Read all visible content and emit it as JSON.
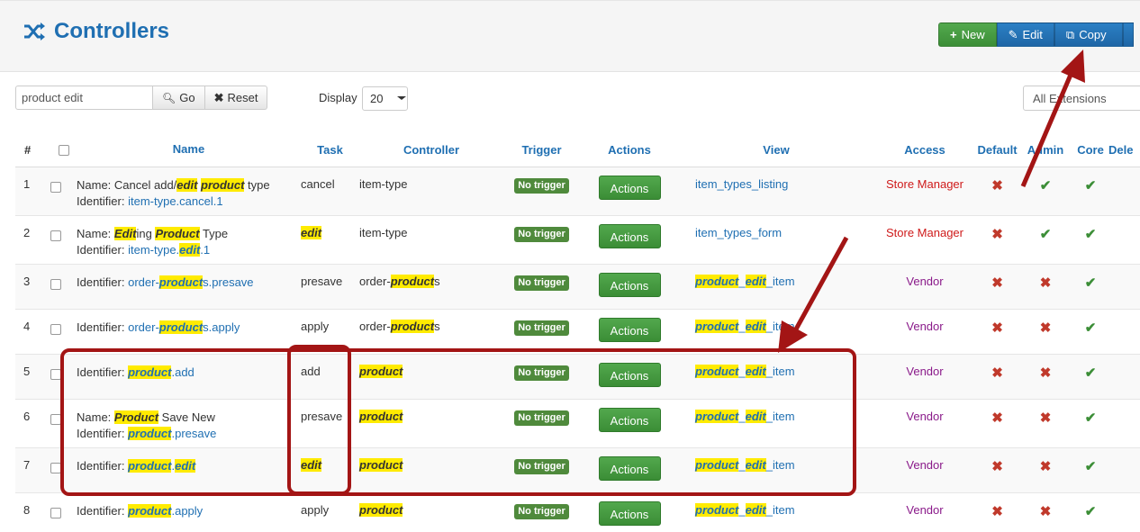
{
  "header": {
    "title": "Controllers",
    "title_icon": "shuffle-icon",
    "toolbar": {
      "new_label": "New",
      "edit_label": "Edit",
      "copy_label": "Copy"
    }
  },
  "filters": {
    "search_value": "product edit",
    "go_label": "Go",
    "reset_label": "Reset",
    "display_label": "Display",
    "display_value": "20",
    "extensions_value": "All Extensions"
  },
  "columns": [
    "#",
    "",
    "Name",
    "Task",
    "Controller",
    "Trigger",
    "Actions",
    "View",
    "Access",
    "Default",
    "Admin",
    "Core",
    "Dele"
  ],
  "rows": [
    {
      "num": "1",
      "name_line": [
        {
          "t": "Name: Cancel add/"
        },
        {
          "t": "edit",
          "h": true
        },
        {
          "t": " "
        },
        {
          "t": "product",
          "h": true
        },
        {
          "t": " type"
        }
      ],
      "ident": [
        {
          "t": "item-type.cancel.1"
        }
      ],
      "task": [
        {
          "t": "cancel"
        }
      ],
      "controller": [
        {
          "t": "item-type"
        }
      ],
      "trigger": "No trigger",
      "actions": "Actions",
      "view": [
        {
          "t": "item_types_listing"
        }
      ],
      "access": "Store Manager",
      "access_type": "store",
      "default": "x",
      "admin": "v",
      "core": "v"
    },
    {
      "num": "2",
      "name_line": [
        {
          "t": "Name: "
        },
        {
          "t": "Edit",
          "h": true
        },
        {
          "t": "ing "
        },
        {
          "t": "Product",
          "h": true
        },
        {
          "t": " Type"
        }
      ],
      "ident": [
        {
          "t": "item-type."
        },
        {
          "t": "edit",
          "h": true
        },
        {
          "t": ".1"
        }
      ],
      "task": [
        {
          "t": "edit",
          "h": true
        }
      ],
      "controller": [
        {
          "t": "item-type"
        }
      ],
      "trigger": "No trigger",
      "actions": "Actions",
      "view": [
        {
          "t": "item_types_form"
        }
      ],
      "access": "Store Manager",
      "access_type": "store",
      "default": "x",
      "admin": "v",
      "core": "v"
    },
    {
      "num": "3",
      "name_line": null,
      "ident": [
        {
          "t": "order-"
        },
        {
          "t": "product",
          "h": true
        },
        {
          "t": "s.presave"
        }
      ],
      "task": [
        {
          "t": "presave"
        }
      ],
      "controller": [
        {
          "t": "order-"
        },
        {
          "t": "product",
          "h": true
        },
        {
          "t": "s"
        }
      ],
      "trigger": "No trigger",
      "actions": "Actions",
      "view": [
        {
          "t": "product",
          "h": true
        },
        {
          "t": "_"
        },
        {
          "t": "edit",
          "h": true
        },
        {
          "t": "_item"
        }
      ],
      "access": "Vendor",
      "access_type": "vendor",
      "default": "x",
      "admin": "x",
      "core": "v"
    },
    {
      "num": "4",
      "name_line": null,
      "ident": [
        {
          "t": "order-"
        },
        {
          "t": "product",
          "h": true
        },
        {
          "t": "s.apply"
        }
      ],
      "task": [
        {
          "t": "apply"
        }
      ],
      "controller": [
        {
          "t": "order-"
        },
        {
          "t": "product",
          "h": true
        },
        {
          "t": "s"
        }
      ],
      "trigger": "No trigger",
      "actions": "Actions",
      "view": [
        {
          "t": "product",
          "h": true
        },
        {
          "t": "_"
        },
        {
          "t": "edit",
          "h": true
        },
        {
          "t": "_item"
        }
      ],
      "access": "Vendor",
      "access_type": "vendor",
      "default": "x",
      "admin": "x",
      "core": "v"
    },
    {
      "num": "5",
      "name_line": null,
      "ident": [
        {
          "t": "product",
          "h": true
        },
        {
          "t": ".add"
        }
      ],
      "task": [
        {
          "t": "add"
        }
      ],
      "controller": [
        {
          "t": "product",
          "h": true
        }
      ],
      "trigger": "No trigger",
      "actions": "Actions",
      "view": [
        {
          "t": "product",
          "h": true
        },
        {
          "t": "_"
        },
        {
          "t": "edit",
          "h": true
        },
        {
          "t": "_item"
        }
      ],
      "access": "Vendor",
      "access_type": "vendor",
      "default": "x",
      "admin": "x",
      "core": "v"
    },
    {
      "num": "6",
      "name_line": [
        {
          "t": "Name: "
        },
        {
          "t": "Product",
          "h": true
        },
        {
          "t": " Save New"
        }
      ],
      "ident": [
        {
          "t": "product",
          "h": true
        },
        {
          "t": ".presave"
        }
      ],
      "task": [
        {
          "t": "presave"
        }
      ],
      "controller": [
        {
          "t": "product",
          "h": true
        }
      ],
      "trigger": "No trigger",
      "actions": "Actions",
      "view": [
        {
          "t": "product",
          "h": true
        },
        {
          "t": "_"
        },
        {
          "t": "edit",
          "h": true
        },
        {
          "t": "_item"
        }
      ],
      "access": "Vendor",
      "access_type": "vendor",
      "default": "x",
      "admin": "x",
      "core": "v"
    },
    {
      "num": "7",
      "name_line": null,
      "ident": [
        {
          "t": "product",
          "h": true
        },
        {
          "t": "."
        },
        {
          "t": "edit",
          "h": true
        }
      ],
      "task": [
        {
          "t": "edit",
          "h": true
        }
      ],
      "controller": [
        {
          "t": "product",
          "h": true
        }
      ],
      "trigger": "No trigger",
      "actions": "Actions",
      "view": [
        {
          "t": "product",
          "h": true
        },
        {
          "t": "_"
        },
        {
          "t": "edit",
          "h": true
        },
        {
          "t": "_item"
        }
      ],
      "access": "Vendor",
      "access_type": "vendor",
      "default": "x",
      "admin": "x",
      "core": "v"
    },
    {
      "num": "8",
      "name_line": null,
      "ident": [
        {
          "t": "product",
          "h": true
        },
        {
          "t": ".apply"
        }
      ],
      "task": [
        {
          "t": "apply"
        }
      ],
      "controller": [
        {
          "t": "product",
          "h": true
        }
      ],
      "trigger": "No trigger",
      "actions": "Actions",
      "view": [
        {
          "t": "product",
          "h": true
        },
        {
          "t": "_"
        },
        {
          "t": "edit",
          "h": true
        },
        {
          "t": "_item"
        }
      ],
      "access": "Vendor",
      "access_type": "vendor",
      "default": "x",
      "admin": "x",
      "core": "v"
    }
  ],
  "labels": {
    "name_prefix": "Name: ",
    "identifier_prefix": "Identifier: "
  },
  "colors": {
    "title": "#1f6fb2",
    "annotation": "#a31515",
    "highlight": "#ffeb00"
  }
}
